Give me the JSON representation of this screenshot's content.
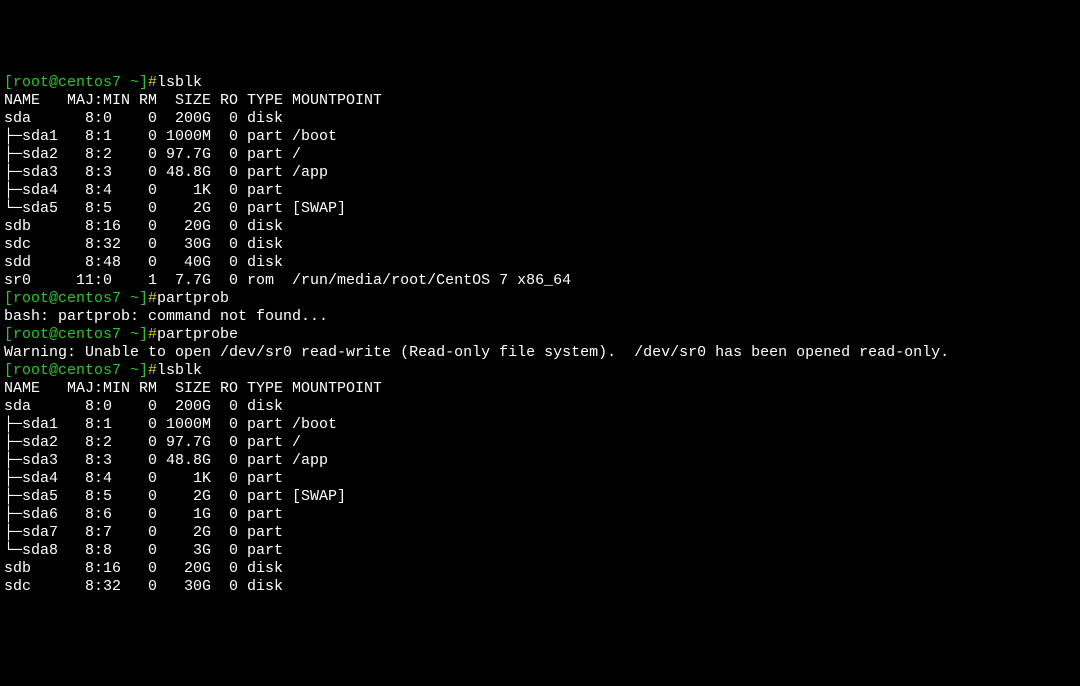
{
  "prompt_user_host": "[root@centos7 ~]",
  "prompt_hash": "#",
  "commands": {
    "lsblk1": "lsblk",
    "partprob": "partprob",
    "partprobe": "partprobe",
    "lsblk2": "lsblk"
  },
  "lsblk1_header": "NAME   MAJ:MIN RM  SIZE RO TYPE MOUNTPOINT",
  "lsblk1_rows": [
    "sda      8:0    0  200G  0 disk ",
    "├─sda1   8:1    0 1000M  0 part /boot",
    "├─sda2   8:2    0 97.7G  0 part /",
    "├─sda3   8:3    0 48.8G  0 part /app",
    "├─sda4   8:4    0    1K  0 part ",
    "└─sda5   8:5    0    2G  0 part [SWAP]",
    "sdb      8:16   0   20G  0 disk ",
    "sdc      8:32   0   30G  0 disk ",
    "sdd      8:48   0   40G  0 disk ",
    "sr0     11:0    1  7.7G  0 rom  /run/media/root/CentOS 7 x86_64"
  ],
  "bash_error": "bash: partprob: command not found...",
  "partprobe_warning": "Warning: Unable to open /dev/sr0 read-write (Read-only file system).  /dev/sr0 has been opened read-only.",
  "lsblk2_header": "NAME   MAJ:MIN RM  SIZE RO TYPE MOUNTPOINT",
  "lsblk2_rows": [
    "sda      8:0    0  200G  0 disk ",
    "├─sda1   8:1    0 1000M  0 part /boot",
    "├─sda2   8:2    0 97.7G  0 part /",
    "├─sda3   8:3    0 48.8G  0 part /app",
    "├─sda4   8:4    0    1K  0 part ",
    "├─sda5   8:5    0    2G  0 part [SWAP]",
    "├─sda6   8:6    0    1G  0 part ",
    "├─sda7   8:7    0    2G  0 part ",
    "└─sda8   8:8    0    3G  0 part ",
    "sdb      8:16   0   20G  0 disk ",
    "sdc      8:32   0   30G  0 disk "
  ]
}
